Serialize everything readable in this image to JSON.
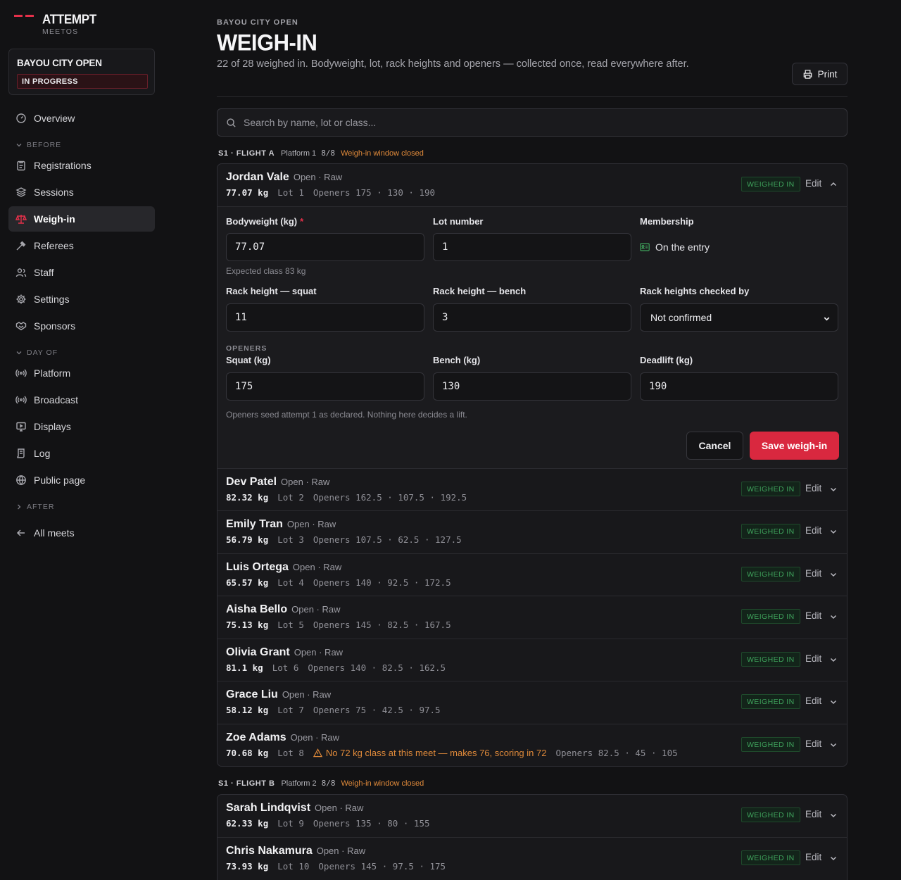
{
  "brand": {
    "name": "ATTEMPT",
    "sub": "MEETOS",
    "accent": "#e5304a"
  },
  "meet": {
    "name": "BAYOU CITY OPEN",
    "status": "IN PROGRESS"
  },
  "nav": {
    "overview": "Overview",
    "before_label": "BEFORE",
    "before": [
      "Registrations",
      "Sessions",
      "Weigh-in",
      "Referees",
      "Staff",
      "Settings",
      "Sponsors"
    ],
    "dayof_label": "DAY OF",
    "dayof": [
      "Platform",
      "Broadcast",
      "Displays",
      "Log",
      "Public page"
    ],
    "after_label": "AFTER",
    "all_meets": "All meets"
  },
  "header": {
    "eyebrow": "BAYOU CITY OPEN",
    "title": "WEIGH-IN",
    "subtitle": "22 of 28 weighed in. Bodyweight, lot, rack heights and openers — collected once, read everywhere after.",
    "print_label": "Print"
  },
  "search": {
    "placeholder": "Search by name, lot or class..."
  },
  "labels": {
    "status": "WEIGHED IN",
    "edit": "Edit",
    "kg": "kg",
    "lot": "Lot",
    "openers": "Openers",
    "sep": "·"
  },
  "flights": [
    {
      "code": "S1 · FLIGHT A",
      "platform": "Platform 1",
      "count": "8/8",
      "warning": "Weigh-in window closed"
    },
    {
      "code": "S1 · FLIGHT B",
      "platform": "Platform 2",
      "count": "8/8",
      "warning": "Weigh-in window closed"
    }
  ],
  "editor": {
    "bodyweight_label": "Bodyweight (kg)",
    "bodyweight_value": "77.07",
    "bodyweight_hint": "Expected class 83 kg",
    "lot_label": "Lot number",
    "lot_value": "1",
    "membership_label": "Membership",
    "membership_value": "On the entry",
    "rack_squat_label": "Rack height — squat",
    "rack_squat_value": "11",
    "rack_bench_label": "Rack height — bench",
    "rack_bench_value": "3",
    "rack_checked_label": "Rack heights checked by",
    "rack_checked_value": "Not confirmed",
    "openers_eyebrow": "OPENERS",
    "squat_label": "Squat (kg)",
    "squat_value": "175",
    "bench_label": "Bench (kg)",
    "bench_value": "130",
    "deadlift_label": "Deadlift (kg)",
    "deadlift_value": "190",
    "openers_hint": "Openers seed attempt 1 as declared. Nothing here decides a lift.",
    "cancel_label": "Cancel",
    "save_label": "Save weigh-in"
  },
  "lifters": [
    {
      "name": "Jordan Vale",
      "division": "Open · Raw",
      "bw": "77.07",
      "lot": "1",
      "openers": [
        "175",
        "130",
        "190"
      ],
      "flag": ""
    },
    {
      "name": "Dev Patel",
      "division": "Open · Raw",
      "bw": "82.32",
      "lot": "2",
      "openers": [
        "162.5",
        "107.5",
        "192.5"
      ],
      "flag": ""
    },
    {
      "name": "Emily Tran",
      "division": "Open · Raw",
      "bw": "56.79",
      "lot": "3",
      "openers": [
        "107.5",
        "62.5",
        "127.5"
      ],
      "flag": ""
    },
    {
      "name": "Luis Ortega",
      "division": "Open · Raw",
      "bw": "65.57",
      "lot": "4",
      "openers": [
        "140",
        "92.5",
        "172.5"
      ],
      "flag": ""
    },
    {
      "name": "Aisha Bello",
      "division": "Open · Raw",
      "bw": "75.13",
      "lot": "5",
      "openers": [
        "145",
        "82.5",
        "167.5"
      ],
      "flag": ""
    },
    {
      "name": "Olivia Grant",
      "division": "Open · Raw",
      "bw": "81.1",
      "lot": "6",
      "openers": [
        "140",
        "82.5",
        "162.5"
      ],
      "flag": ""
    },
    {
      "name": "Grace Liu",
      "division": "Open · Raw",
      "bw": "58.12",
      "lot": "7",
      "openers": [
        "75",
        "42.5",
        "97.5"
      ],
      "flag": ""
    },
    {
      "name": "Zoe Adams",
      "division": "Open · Raw",
      "bw": "70.68",
      "lot": "8",
      "openers": [
        "82.5",
        "45",
        "105"
      ],
      "flag": "No 72 kg class at this meet — makes 76, scoring in 72"
    },
    {
      "name": "Sarah Lindqvist",
      "division": "Open · Raw",
      "bw": "62.33",
      "lot": "9",
      "openers": [
        "135",
        "80",
        "155"
      ],
      "flag": ""
    },
    {
      "name": "Chris Nakamura",
      "division": "Open · Raw",
      "bw": "73.93",
      "lot": "10",
      "openers": [
        "145",
        "97.5",
        "175"
      ],
      "flag": ""
    }
  ]
}
